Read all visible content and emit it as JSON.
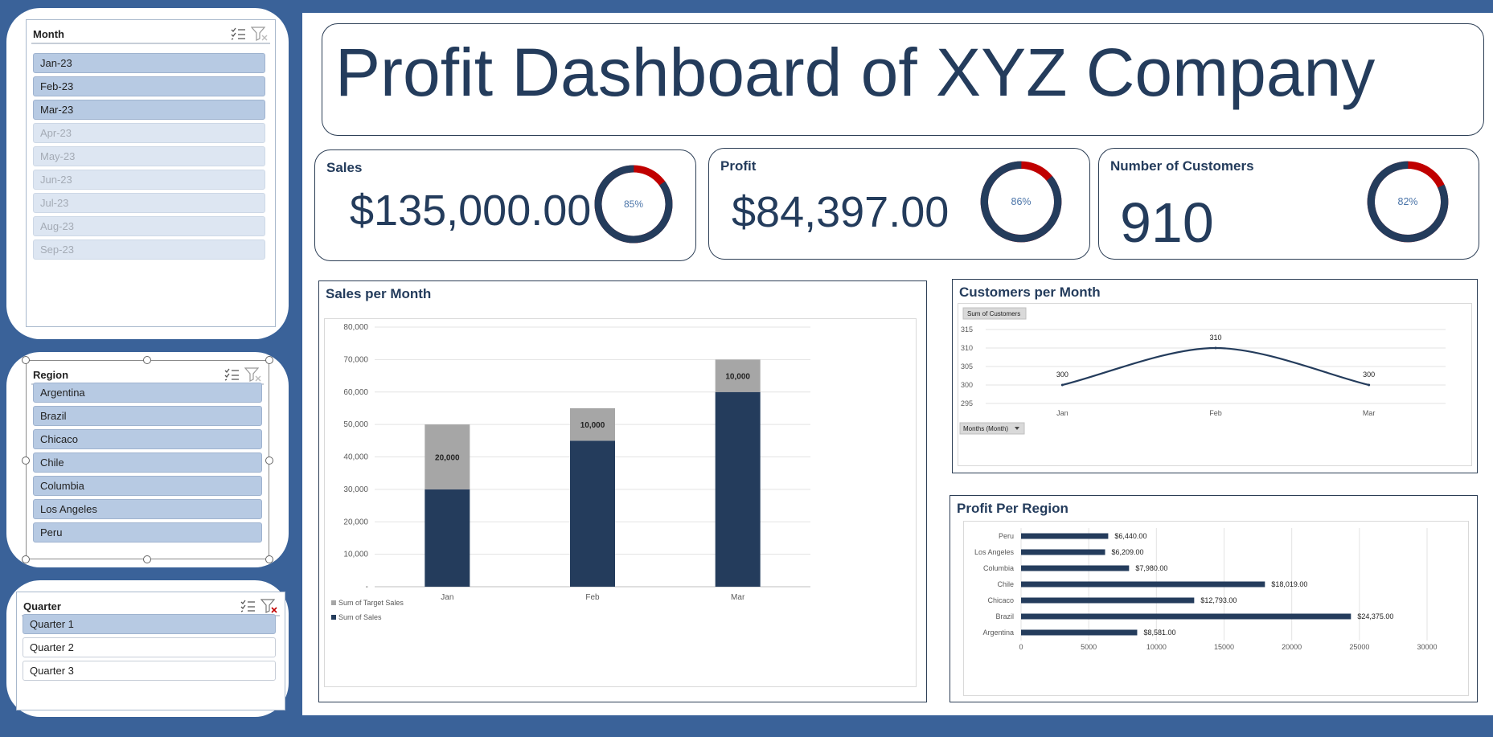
{
  "slicers": {
    "month": {
      "title": "Month",
      "items": [
        {
          "label": "Jan-23",
          "selected": true
        },
        {
          "label": "Feb-23",
          "selected": true
        },
        {
          "label": "Mar-23",
          "selected": true
        },
        {
          "label": "Apr-23",
          "selected": false
        },
        {
          "label": "May-23",
          "selected": false
        },
        {
          "label": "Jun-23",
          "selected": false
        },
        {
          "label": "Jul-23",
          "selected": false
        },
        {
          "label": "Aug-23",
          "selected": false
        },
        {
          "label": "Sep-23",
          "selected": false
        }
      ]
    },
    "region": {
      "title": "Region",
      "items": [
        {
          "label": "Argentina",
          "selected": true
        },
        {
          "label": "Brazil",
          "selected": true
        },
        {
          "label": "Chicaco",
          "selected": true
        },
        {
          "label": "Chile",
          "selected": true
        },
        {
          "label": "Columbia",
          "selected": true
        },
        {
          "label": "Los Angeles",
          "selected": true
        },
        {
          "label": "Peru",
          "selected": true
        }
      ]
    },
    "quarter": {
      "title": "Quarter",
      "items": [
        {
          "label": "Quarter 1",
          "selected": true
        },
        {
          "label": "Quarter 2",
          "selected": false
        },
        {
          "label": "Quarter 3",
          "selected": false
        }
      ]
    }
  },
  "dashboard": {
    "title": "Profit Dashboard of XYZ Company"
  },
  "kpis": {
    "sales": {
      "label": "Sales",
      "value": "$135,000.00",
      "percent_label": "85%",
      "percent": 85
    },
    "profit": {
      "label": "Profit",
      "value": "$84,397.00",
      "percent_label": "86%",
      "percent": 86
    },
    "customers": {
      "label": "Number of Customers",
      "value": "910",
      "percent_label": "82%",
      "percent": 82
    }
  },
  "colors": {
    "navy": "#243c5c",
    "gray": "#a6a6a6",
    "red": "#c00000",
    "blue_bg": "#3a6299",
    "slicer_selected": "#b7cae3"
  },
  "chart_data": [
    {
      "type": "bar",
      "stacked": true,
      "title": "Sales per Month",
      "categories": [
        "Jan",
        "Feb",
        "Mar"
      ],
      "series": [
        {
          "name": "Sum of Sales",
          "values": [
            30000,
            45000,
            60000
          ]
        },
        {
          "name": "Sum of Target Sales",
          "values": [
            20000,
            10000,
            10000
          ],
          "labels": [
            "20,000",
            "10,000",
            "10,000"
          ]
        }
      ],
      "ylim": [
        0,
        80000
      ],
      "yticks": [
        "-",
        "10,000",
        "20,000",
        "30,000",
        "40,000",
        "50,000",
        "60,000",
        "70,000",
        "80,000"
      ],
      "legend": "bottom-left",
      "grid": true
    },
    {
      "type": "line",
      "title": "Customers per Month",
      "field_button": "Sum of Customers",
      "axis_button": "Months (Month)",
      "categories": [
        "Jan",
        "Feb",
        "Mar"
      ],
      "series": [
        {
          "name": "Sum of Customers",
          "values": [
            300,
            310,
            300
          ],
          "labels": [
            "300",
            "310",
            "300"
          ]
        }
      ],
      "ylim": [
        295,
        315
      ],
      "yticks": [
        "295",
        "300",
        "305",
        "310",
        "315"
      ],
      "grid": true
    },
    {
      "type": "bar",
      "orientation": "horizontal",
      "title": "Profit Per Region",
      "categories": [
        "Peru",
        "Los Angeles",
        "Columbia",
        "Chile",
        "Chicaco",
        "Brazil",
        "Argentina"
      ],
      "values": [
        6440,
        6209,
        7980,
        18019,
        12793,
        24375,
        8581
      ],
      "labels": [
        "$6,440.00",
        "$6,209.00",
        "$7,980.00",
        "$18,019.00",
        "$12,793.00",
        "$24,375.00",
        "$8,581.00"
      ],
      "xlim": [
        0,
        30000
      ],
      "xticks": [
        "0",
        "5000",
        "10000",
        "15000",
        "20000",
        "25000",
        "30000"
      ],
      "grid": true
    }
  ]
}
